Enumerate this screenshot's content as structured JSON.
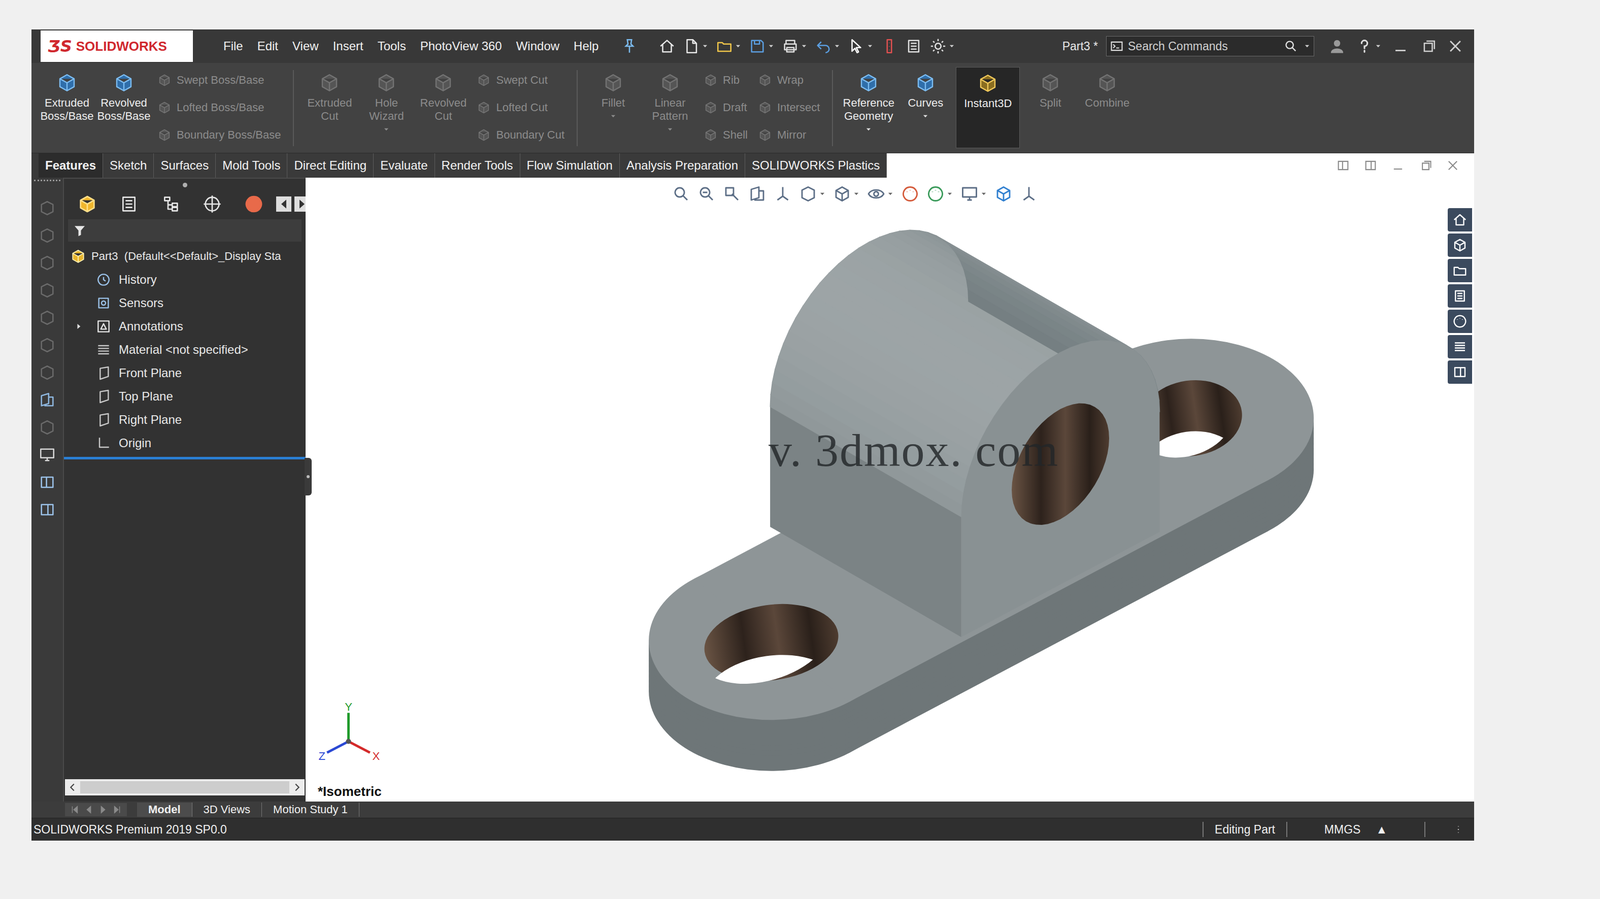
{
  "app": {
    "logo_mark": "ƷS",
    "logo_text": "SOLIDWORKS",
    "document": "Part3 *",
    "search": {
      "placeholder": "Search Commands"
    }
  },
  "menus": [
    "File",
    "Edit",
    "View",
    "Insert",
    "Tools",
    "PhotoView 360",
    "Window",
    "Help"
  ],
  "ribbon": [
    [
      {
        "kind": "large",
        "label": "Extruded Boss/Base",
        "disabled": false,
        "selected": false,
        "dropdown": false
      },
      {
        "kind": "large",
        "label": "Revolved Boss/Base",
        "disabled": false,
        "selected": false,
        "dropdown": false
      },
      {
        "kind": "stack",
        "items": [
          {
            "label": "Swept Boss/Base",
            "disabled": true
          },
          {
            "label": "Lofted Boss/Base",
            "disabled": true
          },
          {
            "label": "Boundary Boss/Base",
            "disabled": true
          }
        ]
      }
    ],
    [
      {
        "kind": "large",
        "label": "Extruded Cut",
        "disabled": true,
        "selected": false,
        "dropdown": false
      },
      {
        "kind": "large",
        "label": "Hole Wizard",
        "disabled": true,
        "selected": false,
        "dropdown": true
      },
      {
        "kind": "large",
        "label": "Revolved Cut",
        "disabled": true,
        "selected": false,
        "dropdown": false
      },
      {
        "kind": "stack",
        "items": [
          {
            "label": "Swept Cut",
            "disabled": true
          },
          {
            "label": "Lofted Cut",
            "disabled": true
          },
          {
            "label": "Boundary Cut",
            "disabled": true
          }
        ]
      }
    ],
    [
      {
        "kind": "large",
        "label": "Fillet",
        "disabled": true,
        "selected": false,
        "dropdown": true
      },
      {
        "kind": "large",
        "label": "Linear Pattern",
        "disabled": true,
        "selected": false,
        "dropdown": true
      },
      {
        "kind": "stack",
        "items": [
          {
            "label": "Rib",
            "disabled": true
          },
          {
            "label": "Draft",
            "disabled": true
          },
          {
            "label": "Shell",
            "disabled": true
          }
        ]
      },
      {
        "kind": "stack",
        "items": [
          {
            "label": "Wrap",
            "disabled": true
          },
          {
            "label": "Intersect",
            "disabled": true
          },
          {
            "label": "Mirror",
            "disabled": true
          }
        ]
      }
    ],
    [
      {
        "kind": "large",
        "label": "Reference Geometry",
        "disabled": false,
        "selected": false,
        "dropdown": true
      },
      {
        "kind": "large",
        "label": "Curves",
        "disabled": false,
        "selected": false,
        "dropdown": true
      },
      {
        "kind": "large",
        "label": "Instant3D",
        "disabled": false,
        "selected": true,
        "dropdown": false
      },
      {
        "kind": "large",
        "label": "Split",
        "disabled": true,
        "selected": false,
        "dropdown": false
      },
      {
        "kind": "large",
        "label": "Combine",
        "disabled": true,
        "selected": false,
        "dropdown": false
      }
    ]
  ],
  "command_tabs": [
    {
      "label": "Features",
      "selected": true
    },
    {
      "label": "Sketch",
      "selected": false
    },
    {
      "label": "Surfaces",
      "selected": false
    },
    {
      "label": "Mold Tools",
      "selected": false
    },
    {
      "label": "Direct Editing",
      "selected": false
    },
    {
      "label": "Evaluate",
      "selected": false
    },
    {
      "label": "Render Tools",
      "selected": false
    },
    {
      "label": "Flow Simulation",
      "selected": false
    },
    {
      "label": "Analysis Preparation",
      "selected": false
    },
    {
      "label": "SOLIDWORKS Plastics",
      "selected": false
    }
  ],
  "feature_tree": {
    "root": "Part3  (Default<<Default>_Display Sta",
    "items": [
      {
        "label": "History",
        "expandable": false,
        "expanded": false
      },
      {
        "label": "Sensors",
        "expandable": false,
        "expanded": false
      },
      {
        "label": "Annotations",
        "expandable": true,
        "expanded": false
      },
      {
        "label": "Material <not specified>",
        "expandable": false,
        "expanded": false
      },
      {
        "label": "Front Plane",
        "expandable": false,
        "expanded": false
      },
      {
        "label": "Top Plane",
        "expandable": false,
        "expanded": false
      },
      {
        "label": "Right Plane",
        "expandable": false,
        "expanded": false
      },
      {
        "label": "Origin",
        "expandable": false,
        "expanded": false
      }
    ]
  },
  "viewport": {
    "view_label": "*Isometric",
    "watermark": "v. 3dmox. com",
    "triad": {
      "x": "X",
      "y": "Y",
      "z": "Z"
    }
  },
  "bottom_tabs": [
    {
      "label": "Model",
      "selected": true
    },
    {
      "label": "3D Views",
      "selected": false
    },
    {
      "label": "Motion Study 1",
      "selected": false
    }
  ],
  "status_bar": {
    "product": "SOLIDWORKS Premium 2019 SP0.0",
    "mode": "Editing Part",
    "units": "MMGS",
    "units_arrow": "▲"
  }
}
